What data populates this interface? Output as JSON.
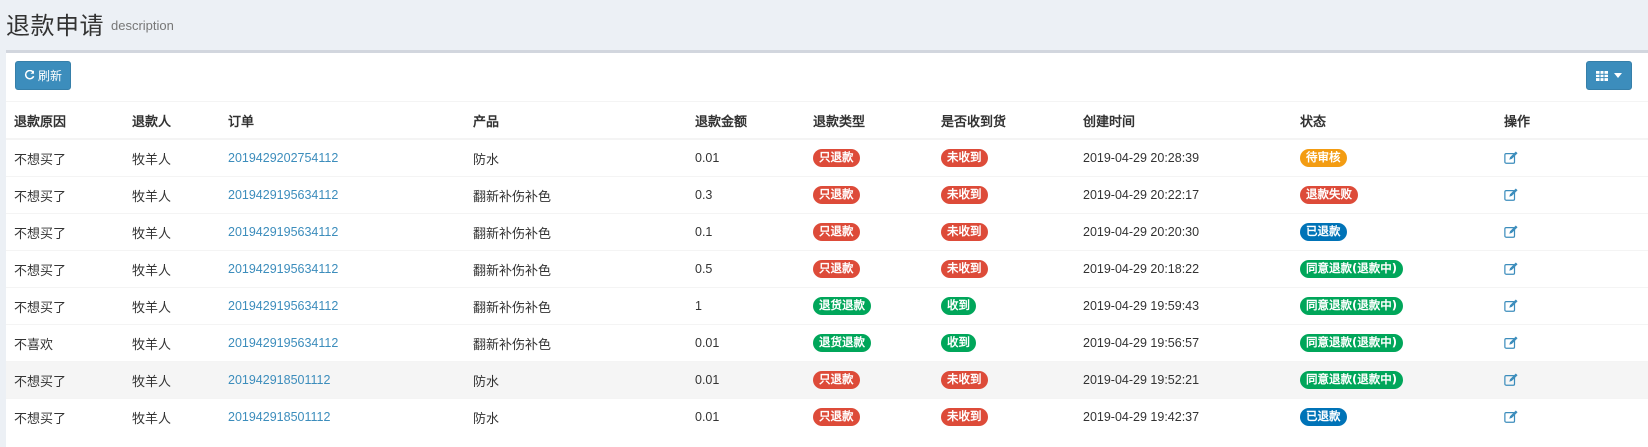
{
  "header": {
    "title": "退款申请",
    "description": "description"
  },
  "toolbar": {
    "refresh_label": "刷新"
  },
  "colors": {
    "primary": "#3c8dbc",
    "red": "#dd4b39",
    "green": "#00a65a",
    "orange": "#f39c12",
    "blue": "#0073b7"
  },
  "columns": [
    "退款原因",
    "退款人",
    "订单",
    "产品",
    "退款金额",
    "退款类型",
    "是否收到货",
    "创建时间",
    "状态",
    "操作"
  ],
  "rows": [
    {
      "reason": "不想买了",
      "user": "牧羊人",
      "order": "2019429202754112",
      "product": "防水",
      "amount": "0.01",
      "type": "只退款",
      "type_color": "#dd4b39",
      "received": "未收到",
      "received_color": "#dd4b39",
      "created": "2019-04-29 20:28:39",
      "status": "待审核",
      "status_color": "#f39c12"
    },
    {
      "reason": "不想买了",
      "user": "牧羊人",
      "order": "2019429195634112",
      "product": "翻新补伤补色",
      "amount": "0.3",
      "type": "只退款",
      "type_color": "#dd4b39",
      "received": "未收到",
      "received_color": "#dd4b39",
      "created": "2019-04-29 20:22:17",
      "status": "退款失败",
      "status_color": "#dd4b39"
    },
    {
      "reason": "不想买了",
      "user": "牧羊人",
      "order": "2019429195634112",
      "product": "翻新补伤补色",
      "amount": "0.1",
      "type": "只退款",
      "type_color": "#dd4b39",
      "received": "未收到",
      "received_color": "#dd4b39",
      "created": "2019-04-29 20:20:30",
      "status": "已退款",
      "status_color": "#0073b7"
    },
    {
      "reason": "不想买了",
      "user": "牧羊人",
      "order": "2019429195634112",
      "product": "翻新补伤补色",
      "amount": "0.5",
      "type": "只退款",
      "type_color": "#dd4b39",
      "received": "未收到",
      "received_color": "#dd4b39",
      "created": "2019-04-29 20:18:22",
      "status": "同意退款(退款中)",
      "status_color": "#00a65a"
    },
    {
      "reason": "不想买了",
      "user": "牧羊人",
      "order": "2019429195634112",
      "product": "翻新补伤补色",
      "amount": "1",
      "type": "退货退款",
      "type_color": "#00a65a",
      "received": "收到",
      "received_color": "#00a65a",
      "created": "2019-04-29 19:59:43",
      "status": "同意退款(退款中)",
      "status_color": "#00a65a"
    },
    {
      "reason": "不喜欢",
      "user": "牧羊人",
      "order": "2019429195634112",
      "product": "翻新补伤补色",
      "amount": "0.01",
      "type": "退货退款",
      "type_color": "#00a65a",
      "received": "收到",
      "received_color": "#00a65a",
      "created": "2019-04-29 19:56:57",
      "status": "同意退款(退款中)",
      "status_color": "#00a65a"
    },
    {
      "reason": "不想买了",
      "user": "牧羊人",
      "order": "201942918501112",
      "product": "防水",
      "amount": "0.01",
      "type": "只退款",
      "type_color": "#dd4b39",
      "received": "未收到",
      "received_color": "#dd4b39",
      "created": "2019-04-29 19:52:21",
      "status": "同意退款(退款中)",
      "status_color": "#00a65a"
    },
    {
      "reason": "不想买了",
      "user": "牧羊人",
      "order": "201942918501112",
      "product": "防水",
      "amount": "0.01",
      "type": "只退款",
      "type_color": "#dd4b39",
      "received": "未收到",
      "received_color": "#dd4b39",
      "created": "2019-04-29 19:42:37",
      "status": "已退款",
      "status_color": "#0073b7"
    }
  ]
}
